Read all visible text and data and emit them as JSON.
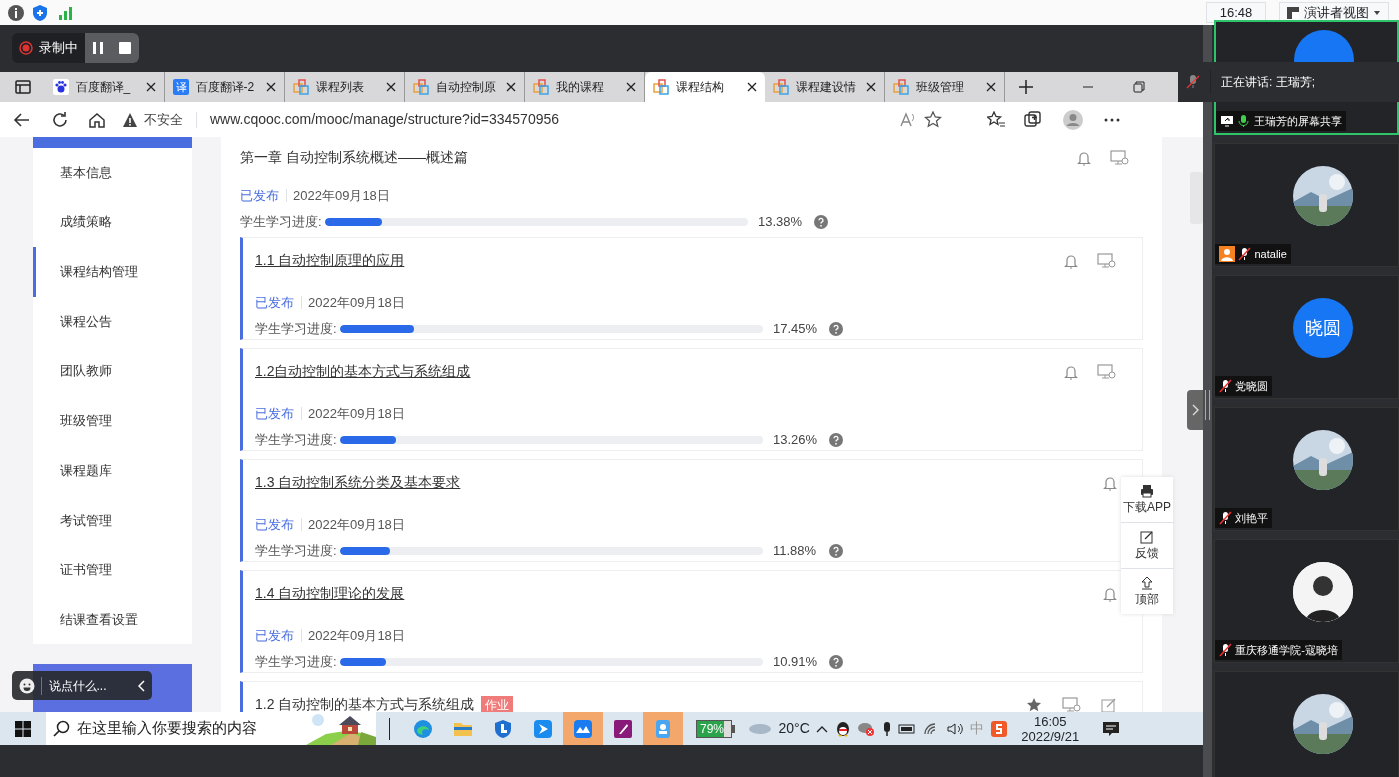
{
  "top_bar": {
    "clock": "16:48",
    "presenter_view": "演讲者视图"
  },
  "recorder": {
    "label": "录制中"
  },
  "browser": {
    "tabs": [
      {
        "kind": "baidu",
        "title": "百度翻译_",
        "selected": false
      },
      {
        "kind": "fanyi",
        "glyph": "译",
        "title": "百度翻译-2",
        "selected": false
      },
      {
        "kind": "course",
        "title": "课程列表",
        "selected": false
      },
      {
        "kind": "course",
        "title": "自动控制原",
        "selected": false
      },
      {
        "kind": "course",
        "title": "我的课程",
        "selected": false
      },
      {
        "kind": "course",
        "title": "课程结构",
        "selected": true
      },
      {
        "kind": "course",
        "title": "课程建设情",
        "selected": false
      },
      {
        "kind": "course",
        "title": "班级管理",
        "selected": false
      }
    ],
    "security": "不安全",
    "url": "www.cqooc.com/mooc/manage/structure?id=334570956"
  },
  "sidebar": {
    "items": [
      {
        "label": "基本信息",
        "selected": false
      },
      {
        "label": "成绩策略",
        "selected": false
      },
      {
        "label": "课程结构管理",
        "selected": true
      },
      {
        "label": "课程公告",
        "selected": false
      },
      {
        "label": "团队教师",
        "selected": false
      },
      {
        "label": "班级管理",
        "selected": false
      },
      {
        "label": "课程题库",
        "selected": false
      },
      {
        "label": "考试管理",
        "selected": false
      },
      {
        "label": "证书管理",
        "selected": false
      },
      {
        "label": "结课查看设置",
        "selected": false
      }
    ]
  },
  "chapter": {
    "title": "第一章 自动控制系统概述——概述篇",
    "status": "已发布",
    "date": "2022年09月18日",
    "progress_label": "学生学习进度:",
    "level": 0.1338,
    "reading": "13.38%"
  },
  "sections": [
    {
      "title": "1.1 自动控制原理的应用",
      "status": "已发布",
      "date": "2022年09月18日",
      "progress_label": "学生学习进度:",
      "level": 0.1745,
      "reading": "17.45%"
    },
    {
      "title": "1.2自动控制的基本方式与系统组成",
      "status": "已发布",
      "date": "2022年09月18日",
      "progress_label": "学生学习进度:",
      "level": 0.1326,
      "reading": "13.26%"
    },
    {
      "title": "1.3 自动控制系统分类及基本要求",
      "status": "已发布",
      "date": "2022年09月18日",
      "progress_label": "学生学习进度:",
      "level": 0.1188,
      "reading": "11.88%"
    },
    {
      "title": "1.4 自动控制理论的发展",
      "status": "已发布",
      "date": "2022年09月18日",
      "progress_label": "学生学习进度:",
      "level": 0.1091,
      "reading": "10.91%"
    }
  ],
  "next_item": {
    "title": "1.2 自动控制的基本方式与系统组成",
    "tag": "作业"
  },
  "float_tools": [
    {
      "kind": "app",
      "label": "下载APP"
    },
    {
      "kind": "feedback",
      "label": "反馈"
    },
    {
      "kind": "top",
      "label": "顶部"
    }
  ],
  "chat": {
    "placeholder": "说点什么..."
  },
  "taskbar": {
    "search_placeholder": "在这里输入你要搜索的内容",
    "apps": [
      {
        "kind": "edge",
        "highlighted": false
      },
      {
        "kind": "folder",
        "highlighted": false
      },
      {
        "kind": "shield",
        "highlighted": false
      },
      {
        "kind": "bluebird",
        "highlighted": false
      },
      {
        "kind": "mountain",
        "highlighted": true
      },
      {
        "kind": "pen",
        "highlighted": false
      },
      {
        "kind": "badge",
        "highlighted": true
      }
    ],
    "battery": {
      "reading": "79%",
      "level": 0.79
    },
    "temperature": "20°C",
    "ime": "中",
    "time": "16:05",
    "date": "2022/9/21"
  },
  "meeting": {
    "speaking": "正在讲话: 王瑞芳;",
    "tiles": [
      {
        "name": "王瑞芳的屏幕共享",
        "kind": "circle",
        "muted": false,
        "sharing": true,
        "active": true
      },
      {
        "name": "natalie",
        "kind": "picture",
        "muted": true,
        "sharing": false,
        "active": false
      },
      {
        "name": "党晓圆",
        "kind": "initials",
        "initials": "晓圆",
        "muted": true,
        "sharing": false,
        "active": false
      },
      {
        "name": "刘艳平",
        "kind": "picture",
        "muted": true,
        "sharing": false,
        "active": false
      },
      {
        "name": "重庆移通学院-寇晓培",
        "kind": "person",
        "muted": true,
        "sharing": false,
        "active": false
      },
      {
        "kind": "picture",
        "active": false
      }
    ]
  }
}
